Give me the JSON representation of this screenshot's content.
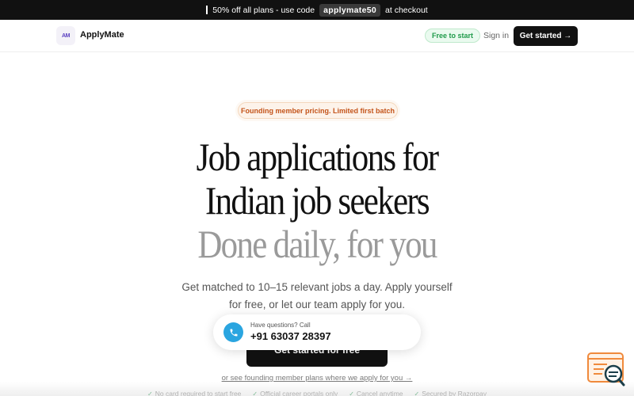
{
  "promo": {
    "prefix": "50% off all plans - use code",
    "code": "applymate50",
    "suffix": "at checkout"
  },
  "header": {
    "logo_text": "AM",
    "brand": "ApplyMate",
    "free_pill": "Free to start",
    "signin": "Sign in",
    "get_started": "Get started →"
  },
  "hero": {
    "badge": "Founding member pricing. Limited first batch",
    "headline_line1": "Job applications for",
    "headline_line2": "Indian job seekers",
    "headline_line3": "Done daily, for you",
    "subtitle_line1": "Get matched to 10–15 relevant jobs a day. Apply yourself",
    "subtitle_line2": "for free, or let our team apply for you.",
    "cta": "Get started for free",
    "founding_link": "or see founding member plans where we apply for you →"
  },
  "call_card": {
    "label": "Have questions? Call",
    "number": "+91 63037 28397"
  },
  "trust": [
    "No card required to start free",
    "Official career portals only",
    "Cancel anytime",
    "Secured by Razorpay"
  ],
  "colors": {
    "accent_dark": "#111111",
    "badge_orange": "#c4541a",
    "free_green": "#1f9a4a",
    "phone_blue": "#2aa5e0",
    "headline_gray": "#9a9a9a"
  }
}
